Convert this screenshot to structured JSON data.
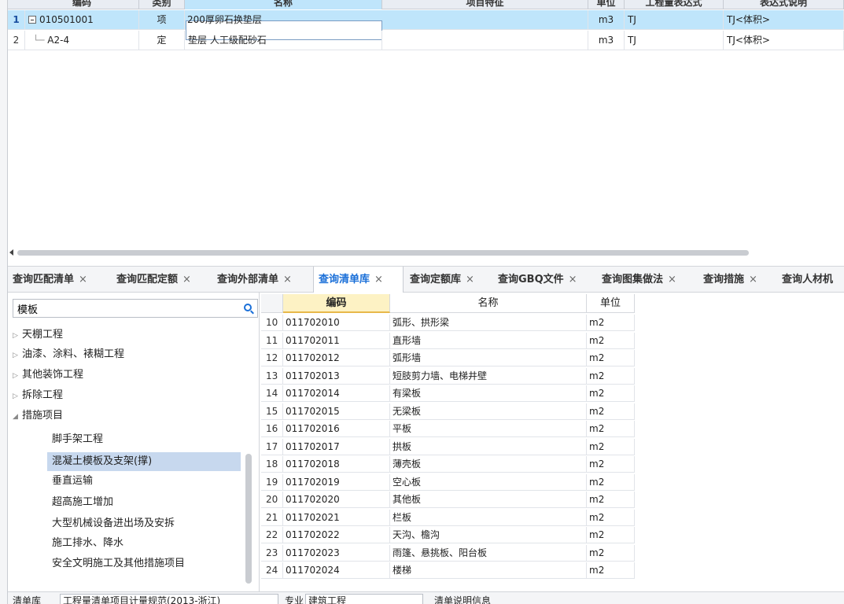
{
  "top_table": {
    "headers": [
      "编码",
      "类别",
      "名称",
      "项目特征",
      "单位",
      "工程量表达式",
      "表达式说明"
    ],
    "rows": [
      {
        "no": "1",
        "code": "010501001",
        "type": "项",
        "name": "200厚卵石换垫层",
        "feature": "",
        "unit": "m3",
        "expr": "TJ",
        "desc": "TJ<体积>"
      },
      {
        "no": "2",
        "code": "A2-4",
        "type": "定",
        "name": "垫层 人工级配砂石",
        "feature": "",
        "unit": "m3",
        "expr": "TJ",
        "desc": "TJ<体积>"
      }
    ]
  },
  "tabs": [
    {
      "label": "查询匹配清单",
      "close": "×"
    },
    {
      "label": "查询匹配定额",
      "close": "×"
    },
    {
      "label": "查询外部清单",
      "close": "×"
    },
    {
      "label": "查询清单库",
      "close": "×"
    },
    {
      "label": "查询定额库",
      "close": "×"
    },
    {
      "label": "查询GBQ文件",
      "close": "×"
    },
    {
      "label": "查询图集做法",
      "close": "×"
    },
    {
      "label": "查询措施",
      "close": "×"
    },
    {
      "label": "查询人材机",
      "close": ""
    }
  ],
  "search": {
    "value": "模板"
  },
  "tree": [
    {
      "label": "天棚工程",
      "arrow": "▷"
    },
    {
      "label": "油漆、涂料、裱糊工程",
      "arrow": "▷"
    },
    {
      "label": "其他装饰工程",
      "arrow": "▷"
    },
    {
      "label": "拆除工程",
      "arrow": "▷"
    },
    {
      "label": "措施项目",
      "arrow": "◢"
    },
    {
      "label": "脚手架工程",
      "arrow": ""
    },
    {
      "label": "混凝土模板及支架(撑)",
      "arrow": ""
    },
    {
      "label": "垂直运输",
      "arrow": ""
    },
    {
      "label": "超高施工增加",
      "arrow": ""
    },
    {
      "label": "大型机械设备进出场及安拆",
      "arrow": ""
    },
    {
      "label": "施工排水、降水",
      "arrow": ""
    },
    {
      "label": "安全文明施工及其他措施项目",
      "arrow": ""
    }
  ],
  "grid": {
    "headers": [
      "编码",
      "名称",
      "单位"
    ],
    "rows": [
      {
        "no": "10",
        "code": "011702010",
        "name": "弧形、拱形梁",
        "unit": "m2"
      },
      {
        "no": "11",
        "code": "011702011",
        "name": "直形墙",
        "unit": "m2"
      },
      {
        "no": "12",
        "code": "011702012",
        "name": "弧形墙",
        "unit": "m2"
      },
      {
        "no": "13",
        "code": "011702013",
        "name": "短肢剪力墙、电梯井壁",
        "unit": "m2"
      },
      {
        "no": "14",
        "code": "011702014",
        "name": "有梁板",
        "unit": "m2"
      },
      {
        "no": "15",
        "code": "011702015",
        "name": "无梁板",
        "unit": "m2"
      },
      {
        "no": "16",
        "code": "011702016",
        "name": "平板",
        "unit": "m2"
      },
      {
        "no": "17",
        "code": "011702017",
        "name": "拱板",
        "unit": "m2"
      },
      {
        "no": "18",
        "code": "011702018",
        "name": "薄壳板",
        "unit": "m2"
      },
      {
        "no": "19",
        "code": "011702019",
        "name": "空心板",
        "unit": "m2"
      },
      {
        "no": "20",
        "code": "011702020",
        "name": "其他板",
        "unit": "m2"
      },
      {
        "no": "21",
        "code": "011702021",
        "name": "栏板",
        "unit": "m2"
      },
      {
        "no": "22",
        "code": "011702022",
        "name": "天沟、檐沟",
        "unit": "m2"
      },
      {
        "no": "23",
        "code": "011702023",
        "name": "雨篷、悬挑板、阳台板",
        "unit": "m2"
      },
      {
        "no": "24",
        "code": "011702024",
        "name": "楼梯",
        "unit": "m2"
      }
    ]
  },
  "bottom": {
    "label1": "清单库",
    "value1": "工程量清单项目计量规范(2013-浙江)",
    "label2": "专业",
    "value2": "建筑工程",
    "label3": "清单说明信息"
  },
  "colors": {
    "accent": "#1a6fd8",
    "selected_row": "#bfe5fb",
    "tree_selected": "#c7d8ee",
    "code_header": "#fdf2c4"
  }
}
